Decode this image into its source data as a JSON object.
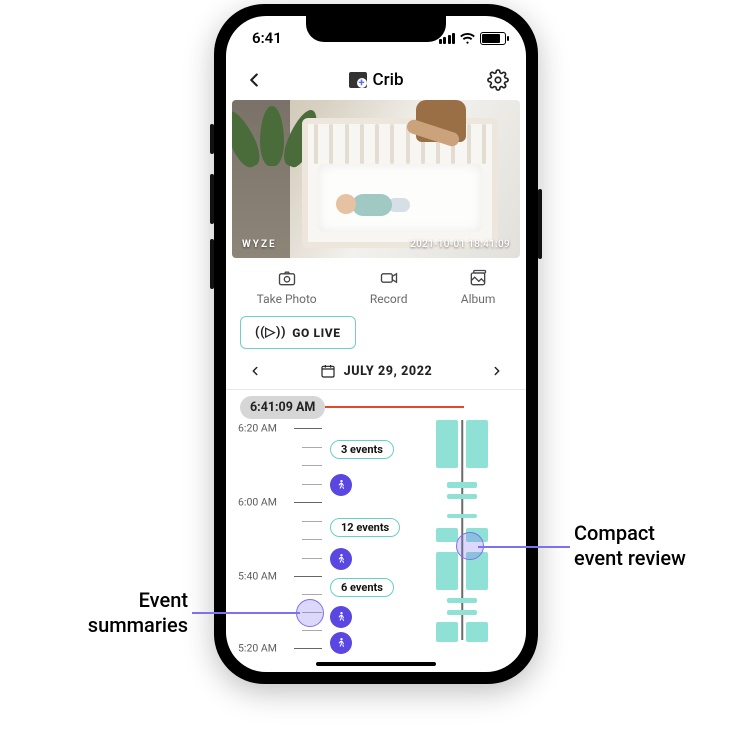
{
  "status": {
    "time": "6:41"
  },
  "header": {
    "title": "Crib"
  },
  "feed": {
    "brand": "WYZE",
    "timestamp": "2021-10-01 18:41:09"
  },
  "actions": {
    "photo": "Take Photo",
    "record": "Record",
    "album": "Album"
  },
  "golive": {
    "label": "GO LIVE",
    "glyph": "((▷))"
  },
  "date": {
    "label": "JULY 29, 2022"
  },
  "timeline": {
    "now": "6:41:09 AM",
    "ticks": {
      "t620": "6:20 AM",
      "t600": "6:00 AM",
      "t540": "5:40 AM",
      "t520": "5:20 AM"
    },
    "chips": {
      "c3": "3 events",
      "c12": "12 events",
      "c6": "6 events"
    }
  },
  "callouts": {
    "left": "Event\nsummaries",
    "right": "Compact\nevent review"
  }
}
